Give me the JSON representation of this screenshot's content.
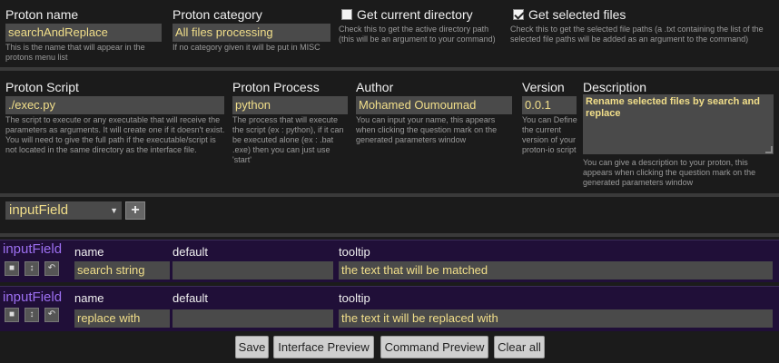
{
  "top": {
    "proton_name": {
      "label": "Proton name",
      "value": "searchAndReplace",
      "help": "This is the name that will appear in the protons menu list"
    },
    "proton_category": {
      "label": "Proton category",
      "value": "All files processing",
      "help": "If no category given it will be put in MISC"
    },
    "get_current_directory": {
      "label": "Get current directory",
      "checked": false,
      "help": "Check this to get the active directory path (this will be an argument to your command)"
    },
    "get_selected_files": {
      "label": "Get selected files",
      "checked": true,
      "help": "Check this to get the selected file paths (a .txt containing the list of the selected file paths will be added as an argument to the command)"
    }
  },
  "middle": {
    "proton_script": {
      "label": "Proton Script",
      "value": "./exec.py",
      "help": "The script to execute or any executable that will receive the parameters as arguments. It will create one if it doesn't exist. You will need to give the full path if the executable/script is not located in the same directory as the interface file."
    },
    "proton_process": {
      "label": "Proton Process",
      "value": "python",
      "help": "The process that will execute the script (ex : python), if it can be executed alone (ex : .bat .exe) then you can just use 'start'"
    },
    "author": {
      "label": "Author",
      "value": "Mohamed Oumoumad",
      "help": "You can input your name, this appears when clicking the question mark on the generated parameters window"
    },
    "version": {
      "label": "Version",
      "value": "0.0.1",
      "help": "You can Define the current version of your proton-io script"
    },
    "description": {
      "label": "Description",
      "value": "Rename selected files by search and replace",
      "help": "You can give a description to your proton, this appears when clicking the question mark on the generated parameters window"
    }
  },
  "type_select": {
    "selected": "inputField",
    "add_icon": "plus-icon"
  },
  "params": [
    {
      "type": "inputField",
      "name_label": "name",
      "default_label": "default",
      "tooltip_label": "tooltip",
      "name": "search string",
      "default": "",
      "tooltip": "the text that will be matched"
    },
    {
      "type": "inputField",
      "name_label": "name",
      "default_label": "default",
      "tooltip_label": "tooltip",
      "name": "replace with",
      "default": "",
      "tooltip": "the text it will be replaced with"
    }
  ],
  "buttons": {
    "save": "Save",
    "interface_preview": "Interface Preview",
    "command_preview": "Command Preview",
    "clear_all": "Clear all"
  }
}
